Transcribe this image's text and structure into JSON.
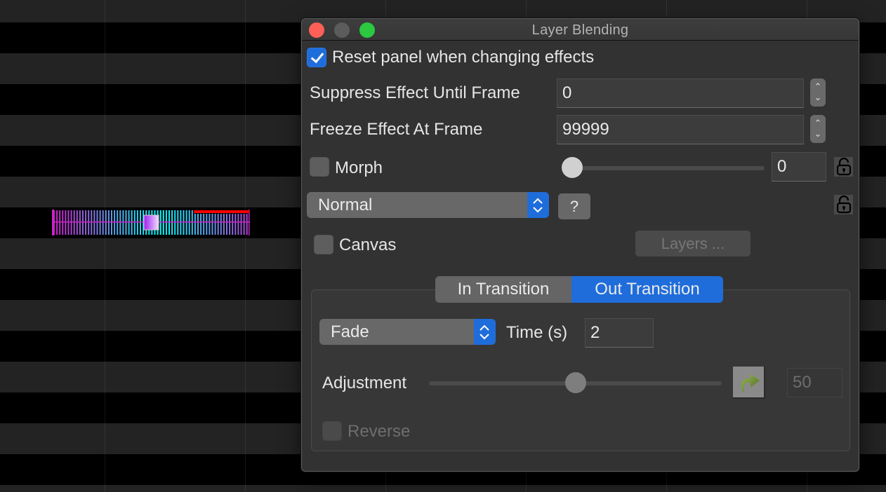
{
  "window": {
    "title": "Layer Blending",
    "controls": [
      "close",
      "minimize",
      "maximize"
    ]
  },
  "reset_panel": {
    "label": "Reset panel when changing effects",
    "checked": true
  },
  "suppress": {
    "label": "Suppress Effect Until Frame",
    "value": "0"
  },
  "freeze": {
    "label": "Freeze Effect At Frame",
    "value": "99999"
  },
  "morph": {
    "label": "Morph",
    "checked": false,
    "slider_value": 0,
    "value": "0",
    "lock_icon": "unlocked-padlock-icon"
  },
  "blend_mode": {
    "selected": "Normal",
    "help_label": "?",
    "lock_icon": "unlocked-padlock-icon"
  },
  "canvas": {
    "label": "Canvas",
    "checked": false,
    "layers_button": "Layers ..."
  },
  "transition": {
    "tabs": [
      {
        "label": "In Transition",
        "active": false
      },
      {
        "label": "Out Transition",
        "active": true
      }
    ],
    "type": "Fade",
    "time_label": "Time (s)",
    "time_value": "2",
    "adjustment_label": "Adjustment",
    "adjustment_value": "50",
    "adjustment_fraction": 0.5,
    "reverse_label": "Reverse",
    "reverse_checked": false
  },
  "background": {
    "clip_colors": {
      "start": "#cc22cc",
      "mid": "#00ffff",
      "marker": "#ff0000",
      "handle": "#a020f0"
    }
  }
}
